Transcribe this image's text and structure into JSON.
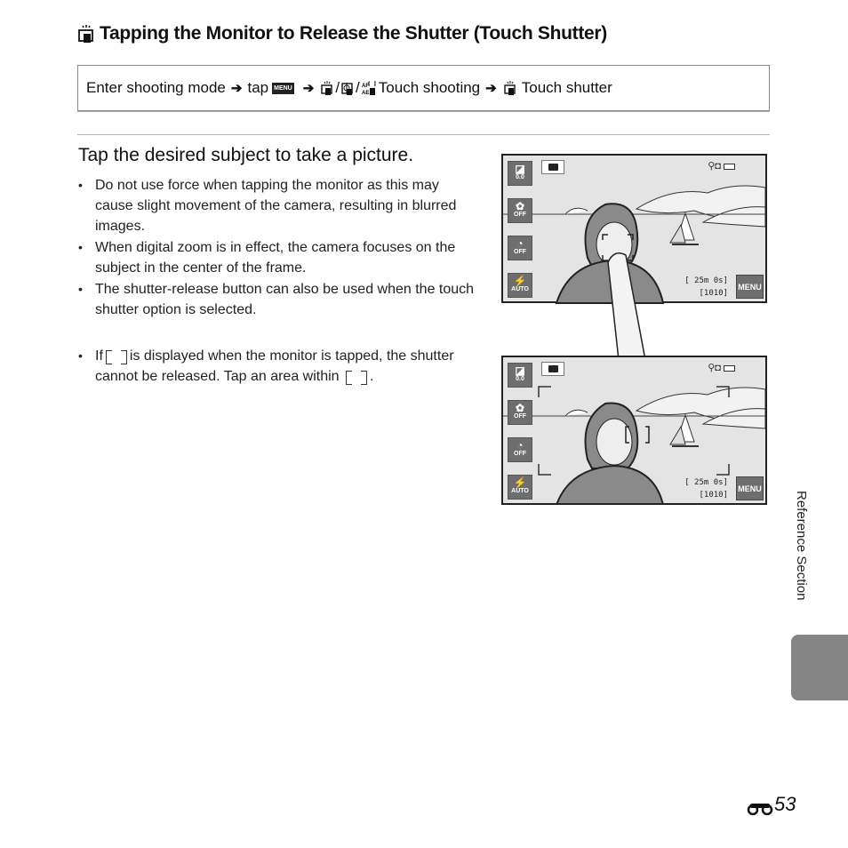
{
  "header": {
    "title": "Tapping the Monitor to Release the Shutter (Touch Shutter)",
    "title_icon": "touch-shutter-icon"
  },
  "path": {
    "step1": "Enter shooting mode",
    "tap": "tap",
    "menu_icon_label": "MENU",
    "touch_modes_label": "Touch shooting",
    "final_label": "Touch shutter",
    "arrow": "➔",
    "separator": "/"
  },
  "section": {
    "heading": "Tap the desired subject to take a picture.",
    "bullets": [
      "Do not use force when tapping the monitor as this may cause slight movement of the camera, resulting in blurred images.",
      "When digital zoom is in effect, the camera focuses on the subject in the center of the frame.",
      "The shutter-release button can also be used when the touch shutter option is selected."
    ],
    "bullet_if": {
      "part1": "If",
      "part2": "is displayed when the monitor is tapped, the shutter cannot be released. Tap an area within",
      "part3": "."
    }
  },
  "screens": [
    {
      "exposure": "0.0",
      "macro": "OFF",
      "self_timer": "OFF",
      "flash": "AUTO",
      "remaining_time": "[  25m  0s]",
      "shots": "[1010]",
      "menu": "MENU"
    },
    {
      "exposure": "0.0",
      "macro": "OFF",
      "self_timer": "OFF",
      "flash": "AUTO",
      "remaining_time": "[  25m  0s]",
      "shots": "[1010]",
      "menu": "MENU"
    }
  ],
  "side_tab": {
    "label": "Reference Section",
    "color": "#858585"
  },
  "footer": {
    "page_prefix_icon": "binoculars-icon",
    "page_number": "53"
  }
}
